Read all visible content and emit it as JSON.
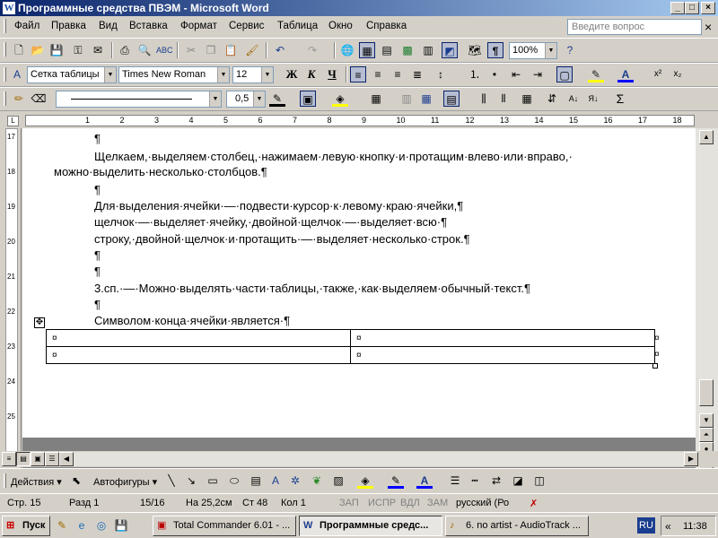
{
  "window": {
    "title": "Программные средства ПВЭМ - Microsoft Word",
    "app_icon": "W"
  },
  "menu": {
    "items": [
      "Файл",
      "Правка",
      "Вид",
      "Вставка",
      "Формат",
      "Сервис",
      "Таблица",
      "Окно",
      "Справка"
    ],
    "ask_placeholder": "Введите вопрос",
    "close_doc": "×"
  },
  "toolbar": {
    "zoom": "100%",
    "style": "Сетка таблицы",
    "font": "Times New Roman",
    "size": "12",
    "bold": "Ж",
    "italic": "К",
    "underline": "Ч",
    "line_weight": "0,5",
    "sigma": "Σ"
  },
  "document": {
    "lines": [
      "¶",
      "Щелкаем,·выделяем·столбец,·нажимаем·левую·кнопку·и·протащим·влево·или·вправо,·",
      "можно·выделить·несколько·столбцов.¶",
      "¶",
      "Для·выделения·ячейки·—·подвести·курсор·к·левому·краю·ячейки,¶",
      "щелчок·—·выделяет·ячейку,·двойной·щелчок·—·выделяет·всю·¶",
      "строку,·двойной·щелчок·и·протащить·—·выделяет·несколько·строк.¶",
      "¶",
      "¶",
      "3.сп.·—·Можно·выделять·части·таблицы,·также,·как·выделяем·обычный·текст.¶",
      "¶",
      "Символом·конца·ячейки·является·¶"
    ],
    "cell_mark": "¤",
    "table_rows": 2,
    "table_cols": 2
  },
  "ruler": {
    "h_marks": [
      "1",
      "2",
      "3",
      "4",
      "5",
      "6",
      "7",
      "8",
      "9",
      "10",
      "11",
      "12",
      "13",
      "14",
      "15",
      "16",
      "17",
      "18"
    ],
    "v_marks": [
      "17",
      "18",
      "19",
      "20",
      "21",
      "22",
      "23",
      "24",
      "25"
    ]
  },
  "drawing": {
    "actions": "Действия",
    "autoshapes": "Автофигуры"
  },
  "status": {
    "page": "Стр. 15",
    "section": "Разд 1",
    "pages": "15/16",
    "at": "На 25,2см",
    "line": "Ст 48",
    "col": "Кол 1",
    "rec": "ЗАП",
    "trk": "ИСПР",
    "ext": "ВДЛ",
    "ovr": "ЗАМ",
    "lang": "русский (Ро"
  },
  "taskbar": {
    "start": "Пуск",
    "tasks": [
      "Total Commander 6.01 - ...",
      "Программные средс...",
      "6. no artist - AudioTrack ..."
    ],
    "lang": "RU",
    "time": "11:38"
  }
}
